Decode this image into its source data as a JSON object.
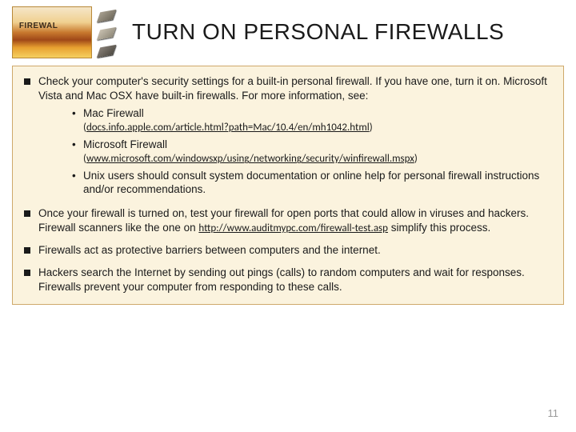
{
  "title": "TURN ON PERSONAL FIREWALLS",
  "page_number": "11",
  "bullets": [
    {
      "text": "Check your computer's security settings for a built-in personal firewall. If you have one, turn it on. Microsoft Vista and Mac OSX have built-in firewalls. For more information, see:",
      "subs": [
        {
          "label": "Mac Firewall",
          "url": "docs.info.apple.com/article.html?path=Mac/10.4/en/mh1042.html"
        },
        {
          "label": "Microsoft Firewall",
          "url": "www.microsoft.com/windowsxp/using/networking/security/winfirewall.mspx"
        },
        {
          "label": "Unix users should consult system documentation or online help for personal firewall instructions and/or recommendations."
        }
      ]
    },
    {
      "text_pre": "Once your firewall is turned on, test your firewall for open ports that could allow in viruses and hackers. Firewall scanners like the one on ",
      "inline_url": "http://www.auditmypc.com/firewall-test.asp",
      "text_post": " simplify this process."
    },
    {
      "text": "Firewalls act as protective barriers between computers and the internet."
    },
    {
      "text": "Hackers search the Internet by sending out pings (calls) to random computers and wait for responses. Firewalls prevent your computer from responding to these calls."
    }
  ]
}
